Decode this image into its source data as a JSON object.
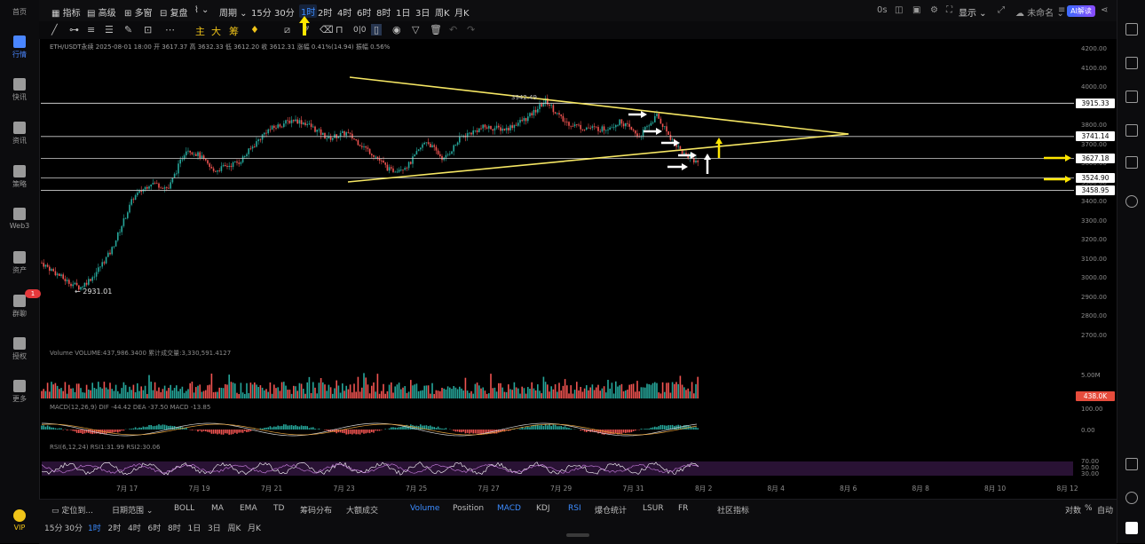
{
  "left_rail": {
    "items": [
      {
        "label": "首页",
        "icon": "home-icon"
      },
      {
        "label": "行情",
        "icon": "chart-bars-icon",
        "active": true
      },
      {
        "label": "快讯",
        "icon": "newsflash-icon"
      },
      {
        "label": "资讯",
        "icon": "news-icon"
      },
      {
        "label": "策略",
        "icon": "strategy-icon"
      },
      {
        "label": "Web3",
        "icon": "web3-icon"
      },
      {
        "label": "资产",
        "icon": "wallet-icon"
      },
      {
        "label": "群聊",
        "icon": "chat-icon"
      },
      {
        "label": "授权",
        "icon": "key-icon"
      },
      {
        "label": "更多",
        "icon": "more-grid-icon"
      }
    ],
    "vip_label": "VIP",
    "badge": "1"
  },
  "topbar": {
    "indicators": "指标",
    "advanced": "高级",
    "multi": "多窗",
    "replay": "复盘",
    "period": "周期",
    "intervals": [
      "15分",
      "30分",
      "1时",
      "2时",
      "4时",
      "6时",
      "8时",
      "1日",
      "3日",
      "周K",
      "月K"
    ],
    "active_interval": "1时",
    "countdown": "0s",
    "display": "显示",
    "account": "未命名",
    "ai_button": "AI解读"
  },
  "drawbar": {
    "main": "主",
    "big": "大",
    "chip": "筹",
    "code": "0|0"
  },
  "chart_header": "ETH/USDT永续 2025-08-01 18:00 开 3617.37 高 3632.33 低 3612.20 收 3612.31 涨幅 0.41%(14.94) 振幅 0.56%",
  "annotations": {
    "high_label": "3942.49",
    "low_label": "2931.01"
  },
  "price_axis": [
    "4200.00",
    "4100.00",
    "4000.00",
    "3900.00",
    "3800.00",
    "3700.00",
    "3600.00",
    "3500.00",
    "3400.00",
    "3300.00",
    "3200.00",
    "3100.00",
    "3000.00",
    "2900.00",
    "2800.00",
    "2700.00"
  ],
  "price_lines": [
    "3915.33",
    "3741.14",
    "3627.18",
    "3524.90",
    "3458.95"
  ],
  "date_axis": [
    "7月 17",
    "7月 19",
    "7月 21",
    "7月 23",
    "7月 25",
    "7月 27",
    "7月 29",
    "7月 31",
    "8月 2",
    "8月 4",
    "8月 6",
    "8月 8",
    "8月 10",
    "8月 12"
  ],
  "volume_panel": {
    "label": "Volume VOLUME:437,986.3400 累计成交量:3,330,591.4127",
    "axis_top": "5.00M",
    "current": "438.0K"
  },
  "macd_panel": {
    "label": "MACD(12,26,9) DIF -44.42 DEA -37.50 MACD -13.85",
    "axis": [
      "100.00",
      "0.00",
      "-100.00"
    ]
  },
  "rsi_panel": {
    "label": "RSI(6,12,24) RSI1:31.99 RSI2:30.06",
    "axis": [
      "70.00",
      "50.00",
      "30.00"
    ]
  },
  "bottombar": {
    "tabs_left": [
      "定位到...",
      "日期范围"
    ],
    "indicators": [
      "BOLL",
      "MA",
      "EMA",
      "TD",
      "筹码分布",
      "大额成交",
      "Volume",
      "Position",
      "MACD",
      "KDJ",
      "RSI",
      "爆仓统计",
      "LSUR",
      "FR",
      "社区指标"
    ],
    "active_indicators": [
      "Volume",
      "MACD",
      "RSI"
    ],
    "intervals": [
      "15分",
      "30分",
      "1时",
      "2时",
      "4时",
      "6时",
      "8时",
      "1日",
      "3日",
      "周K",
      "月K"
    ],
    "active_interval": "1时",
    "right": [
      "对数",
      "%",
      "自动"
    ]
  },
  "colors": {
    "up": "#26a69a",
    "down": "#ef5350",
    "triangle": "#f5e663",
    "accent": "#3c8cff",
    "arrow_yellow": "#ffe600"
  }
}
